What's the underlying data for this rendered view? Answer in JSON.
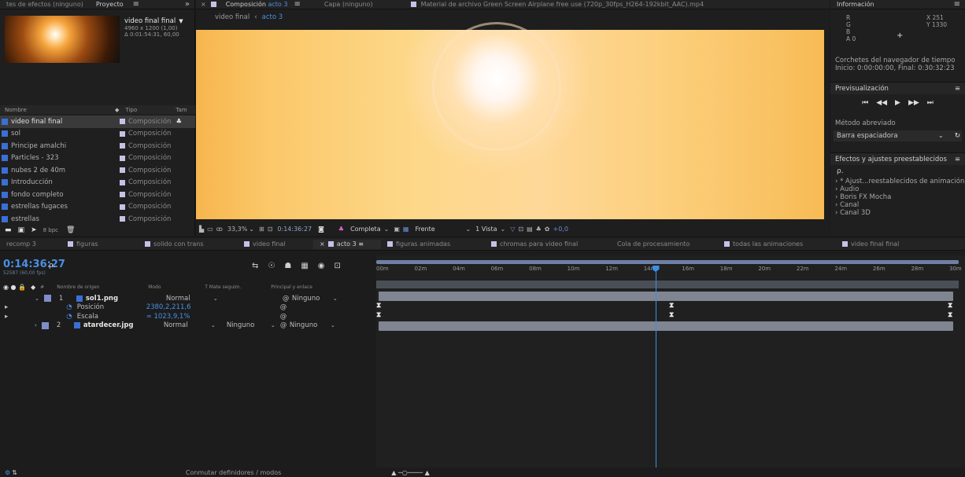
{
  "top_tabs": {
    "effects": "tes de efectos (ninguno)",
    "project": "Proyecto",
    "composition": "Composición",
    "composition_name": "acto 3",
    "layer": "Capa (ninguno)",
    "footage": "Material de archivo Green Screen Airplane  free use (720p_30fps_H264-192kbit_AAC).mp4",
    "info": "Información"
  },
  "project": {
    "comp_name": "video final final",
    "comp_dims": "4960 x 1200 (1,00)",
    "comp_duration": "Δ 0:01:54:31, 60,00",
    "col_name": "Nombre",
    "col_type": "Tipo",
    "col_tam": "Tam",
    "items": [
      {
        "name": "video final final",
        "type": "Composición"
      },
      {
        "name": "sol",
        "type": "Composición"
      },
      {
        "name": "Principe amalchi",
        "type": "Composición"
      },
      {
        "name": "Particles - 323",
        "type": "Composición"
      },
      {
        "name": "nubes 2 de 40m",
        "type": "Composición"
      },
      {
        "name": "Introducción",
        "type": "Composición"
      },
      {
        "name": "fondo completo",
        "type": "Composición"
      },
      {
        "name": "estrellas fugaces",
        "type": "Composición"
      },
      {
        "name": "estrellas",
        "type": "Composición"
      }
    ],
    "bpc": "8 bpc"
  },
  "viewer": {
    "breadcrumb_root": "video final",
    "breadcrumb_current": "acto 3",
    "zoom": "33,3%",
    "timecode": "0:14:36:27",
    "resolution": "Completa",
    "view": "Frente",
    "views": "1 Vista",
    "exposure": "+0,0"
  },
  "info": {
    "r": "R",
    "g": "G",
    "b": "B",
    "a": "A  0",
    "x": "X  251",
    "y": "Y  1330",
    "brackets_title": "Corchetes del navegador de tiempo",
    "brackets_value": "Inicio: 0:00:00:00, Final: 0:30:32:23",
    "preview_title": "Previsualización",
    "shortcut_label": "Método abreviado",
    "shortcut_value": "Barra espaciadora",
    "effects_title": "Efectos y ajustes preestablecidos",
    "effects_items": [
      "* Ajust...reestablecidos de animación",
      "Audio",
      "Boris FX Mocha",
      "Canal",
      "Canal 3D"
    ]
  },
  "timeline": {
    "tabs": [
      {
        "label": "recomp 3",
        "color": ""
      },
      {
        "label": "figuras",
        "color": "#c9c0e6"
      },
      {
        "label": "solido con trans",
        "color": "#c9c0e6"
      },
      {
        "label": "video final",
        "color": "#c9c0e6"
      },
      {
        "label": "acto 3",
        "color": "#c9c0e6"
      },
      {
        "label": "figuras animadas",
        "color": "#c9c0e6"
      },
      {
        "label": "chromas para video final",
        "color": "#c9c0e6"
      },
      {
        "label": "Cola de procesamiento",
        "color": ""
      },
      {
        "label": "todas las animaciones",
        "color": "#c9c0e6"
      },
      {
        "label": "video final final",
        "color": "#c9c0e6"
      }
    ],
    "current_time": "0:14:36:27",
    "frames": "52587 (60,00 fps)",
    "search_placeholder": "ρ.",
    "columns": {
      "source": "Nombre de origen",
      "mode": "Modo",
      "track": "T  Mate seguim.",
      "parent": "Principal y enlace"
    },
    "layers": [
      {
        "num": "1",
        "name": "sol1.png",
        "mode": "Normal",
        "track": "",
        "parent": "Ninguno"
      },
      {
        "num": "2",
        "name": "atardecer.jpg",
        "mode": "Normal",
        "track": "Ninguno",
        "parent": "Ninguno"
      }
    ],
    "props": [
      {
        "name": "Posición",
        "value": "2380,2,211,6"
      },
      {
        "name": "Escala",
        "value": "∞ 1023,9,1%"
      }
    ],
    "ruler": [
      "00m",
      "02m",
      "04m",
      "06m",
      "08m",
      "10m",
      "12m",
      "14m",
      "16m",
      "18m",
      "20m",
      "22m",
      "24m",
      "26m",
      "28m",
      "30m"
    ],
    "playhead_fraction": 0.487,
    "footer": "Conmutar definidores / modos"
  }
}
